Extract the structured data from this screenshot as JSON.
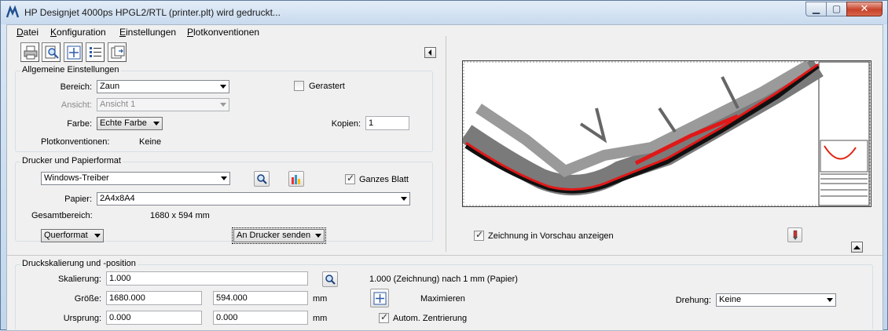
{
  "window": {
    "title": "HP Designjet 4000ps HPGL2/RTL  (printer.plt) wird gedruckt...",
    "app_icon": "plot-app-icon",
    "controls": [
      "minimize-icon",
      "maximize-icon",
      "close-icon"
    ]
  },
  "menu": [
    {
      "mnemonic": "D",
      "rest": "atei"
    },
    {
      "mnemonic": "K",
      "rest": "onfiguration"
    },
    {
      "mnemonic": "E",
      "rest": "instellungen"
    },
    {
      "mnemonic": "P",
      "rest": "lotkonventionen"
    }
  ],
  "toolbar": {
    "icons": [
      "printer-icon",
      "preview-icon",
      "fit-icon",
      "list-icon",
      "export-icon"
    ]
  },
  "general": {
    "title": "Allgemeine Einstellungen",
    "bereich_label": "Bereich:",
    "bereich_value": "Zaun",
    "ansicht_label": "Ansicht:",
    "ansicht_value": "Ansicht 1",
    "farbe_label": "Farbe:",
    "farbe_value": "Echte Farbe",
    "gerastert_label": "Gerastert",
    "gerastert_checked": false,
    "kopien_label": "Kopien:",
    "kopien_value": "1",
    "plotkonv_label": "Plotkonventionen:",
    "plotkonv_value": "Keine"
  },
  "printer": {
    "title": "Drucker und Papierformat",
    "driver_value": "Windows-Treiber",
    "ganzes_blatt_label": "Ganzes Blatt",
    "ganzes_blatt_checked": true,
    "papier_label": "Papier:",
    "papier_value": "2A4x8A4",
    "gesamt_label": "Gesamtbereich:",
    "gesamt_value": "1680 x 594 mm",
    "orientation_value": "Querformat",
    "send_value": "An Drucker senden"
  },
  "preview": {
    "show_label": "Zeichnung in Vorschau anzeigen",
    "show_checked": true
  },
  "scale": {
    "title": "Druckskalierung und -position",
    "skalierung_label": "Skalierung:",
    "skalierung_value": "1.000",
    "scale_info": "1.000  (Zeichnung) nach 1 mm (Papier)",
    "groesse_label": "Größe:",
    "groesse_x": "1680.000",
    "groesse_y": "594.000",
    "unit": "mm",
    "maximieren_label": "Maximieren",
    "drehung_label": "Drehung:",
    "drehung_value": "Keine",
    "ursprung_label": "Ursprung:",
    "ursprung_x": "0.000",
    "ursprung_y": "0.000",
    "zentrierung_label": "Autom. Zentrierung",
    "zentrierung_checked": true
  }
}
